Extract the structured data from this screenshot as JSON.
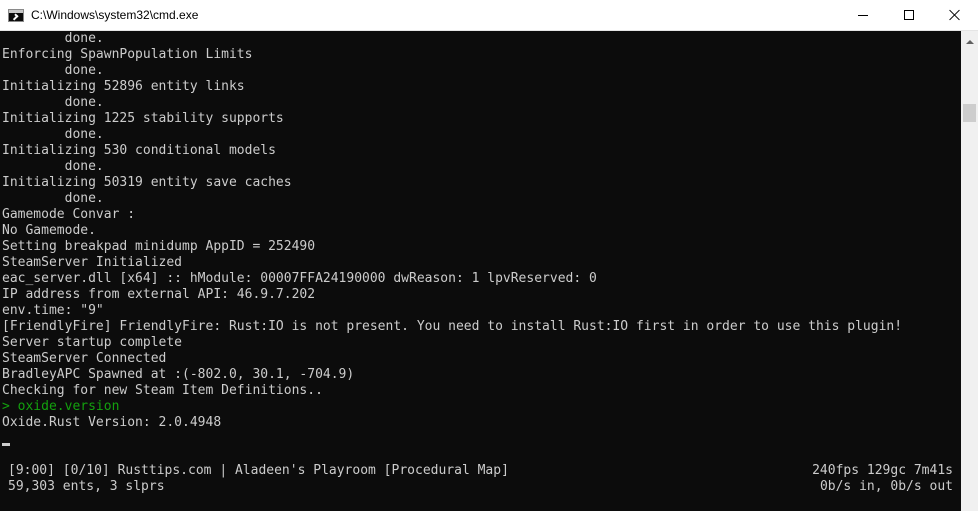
{
  "window": {
    "title": "C:\\Windows\\system32\\cmd.exe",
    "icon": "cmd-icon"
  },
  "console": {
    "lines": [
      "        done.",
      "Enforcing SpawnPopulation Limits",
      "        done.",
      "Initializing 52896 entity links",
      "        done.",
      "Initializing 1225 stability supports",
      "        done.",
      "Initializing 530 conditional models",
      "        done.",
      "Initializing 50319 entity save caches",
      "        done.",
      "Gamemode Convar :",
      "No Gamemode.",
      "Setting breakpad minidump AppID = 252490",
      "SteamServer Initialized",
      "eac_server.dll [x64] :: hModule: 00007FFA24190000 dwReason: 1 lpvReserved: 0",
      "IP address from external API: 46.9.7.202",
      "env.time: \"9\"",
      "[FriendlyFire] FriendlyFire: Rust:IO is not present. You need to install Rust:IO first in order to use this plugin!",
      "Server startup complete",
      "SteamServer Connected",
      "BradleyAPC Spawned at :(-802.0, 30.1, -704.9)",
      "Checking for new Steam Item Definitions..",
      "> oxide.version",
      "Oxide.Rust Version: 2.0.4948"
    ],
    "command_line_index": 23,
    "command_color": "#13a10e",
    "text_color": "#cccccc",
    "background_color": "#0c0c0c"
  },
  "status": {
    "left_1": "[9:00] [0/10] Rusttips.com | Aladeen's Playroom [Procedural Map]",
    "right_1": "240fps 129gc 7m41s",
    "left_2": "59,303 ents, 3 slprs",
    "right_2": "0b/s in, 0b/s out"
  }
}
